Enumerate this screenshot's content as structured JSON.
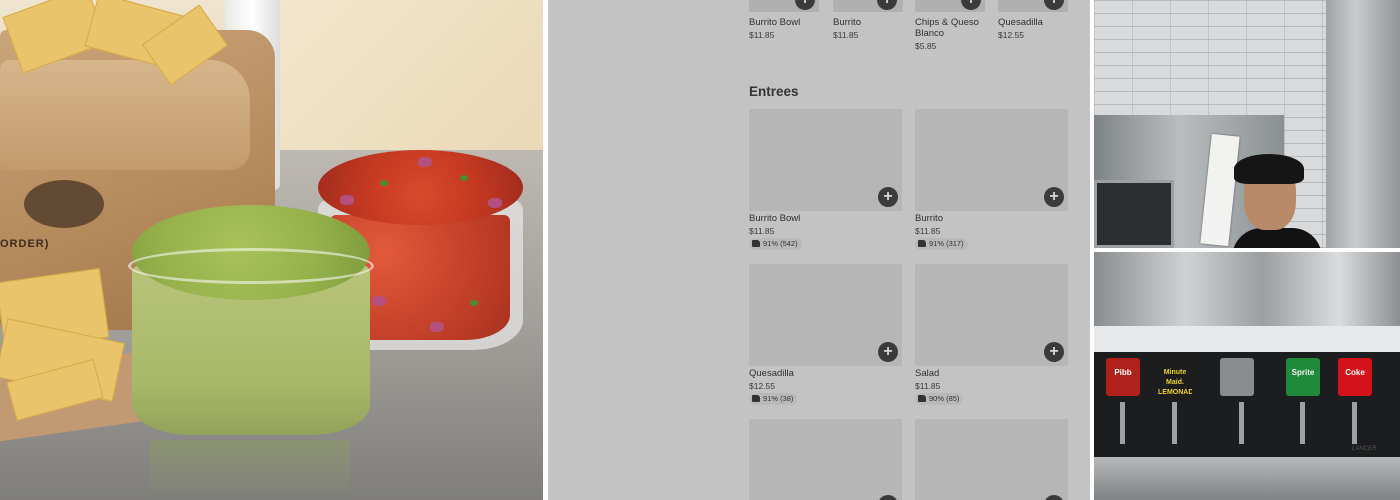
{
  "menu": {
    "top_items": [
      {
        "name": "Burrito Bowl",
        "price": "$11.85"
      },
      {
        "name": "Burrito",
        "price": "$11.85"
      },
      {
        "name": "Chips & Queso Blanco",
        "price": "$5.85"
      },
      {
        "name": "Quesadilla",
        "price": "$12.55"
      }
    ],
    "section_title": "Entrees",
    "entrees": [
      {
        "name": "Burrito Bowl",
        "price": "$11.85",
        "rating": "91% (542)"
      },
      {
        "name": "Burrito",
        "price": "$11.85",
        "rating": "91% (317)"
      },
      {
        "name": "Quesadilla",
        "price": "$12.55",
        "rating": "91% (38)"
      },
      {
        "name": "Salad",
        "price": "$11.85",
        "rating": "90% (85)"
      },
      {
        "name": "",
        "price": "",
        "rating": ""
      },
      {
        "name": "",
        "price": "",
        "rating": ""
      }
    ],
    "add_label": "+"
  },
  "hero_photo": {
    "bag_text": "ORDER)"
  },
  "fountain": {
    "brands": [
      "Pibb",
      "Minute Maid. LEMONADE",
      "Sprite",
      "Coke"
    ],
    "maker_mark": "LANCER"
  },
  "colors": {
    "menu_bg": "#c3c3c3",
    "thumb": "#b6b6b6",
    "add_button": "#3b3b3b",
    "pibb": "#b0211b",
    "minute_maid": "#1d1d1d",
    "sprite": "#1f8a3a",
    "coke": "#d3121a"
  },
  "icons": [
    "plus-icon",
    "thumbs-up-icon"
  ]
}
